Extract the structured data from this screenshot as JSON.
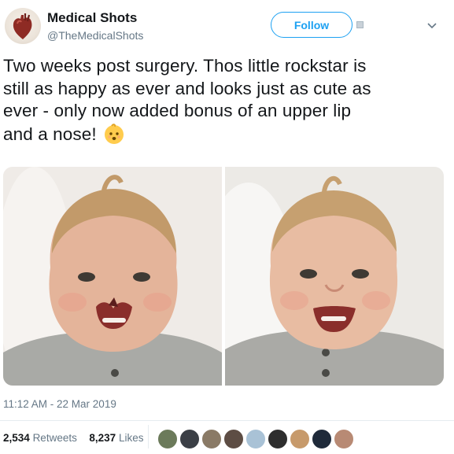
{
  "account": {
    "name": "Medical Shots",
    "handle": "@TheMedicalShots",
    "avatar_icon": "anatomical-heart-icon"
  },
  "follow_label": "Follow",
  "tweet": {
    "lines": [
      "Two weeks post surgery. Thos little rockstar is",
      "still as happy as ever and looks just as cute as",
      "ever - only now added bonus of an upper lip",
      "and a nose!"
    ],
    "emoji": "baby-face-emoji"
  },
  "media": [
    {
      "icon": "baby-photo-before-surgery"
    },
    {
      "icon": "baby-photo-after-surgery"
    }
  ],
  "timestamp": "11:12 AM - 22 Mar 2019",
  "stats": {
    "retweets_count": "2,534",
    "retweets_label": "Retweets",
    "likes_count": "8,237",
    "likes_label": "Likes"
  },
  "liker_avatars": [
    {
      "color": "#6b7a5a"
    },
    {
      "color": "#3b3f46"
    },
    {
      "color": "#8a7a66"
    },
    {
      "color": "#5d4d44"
    },
    {
      "color": "#a9c2d6"
    },
    {
      "color": "#2e2e2e"
    },
    {
      "color": "#c79a6b"
    },
    {
      "color": "#1f2a3a"
    },
    {
      "color": "#b88a74"
    }
  ],
  "colors": {
    "accent": "#1da1f2",
    "text": "#14171a",
    "secondary": "#657786"
  }
}
